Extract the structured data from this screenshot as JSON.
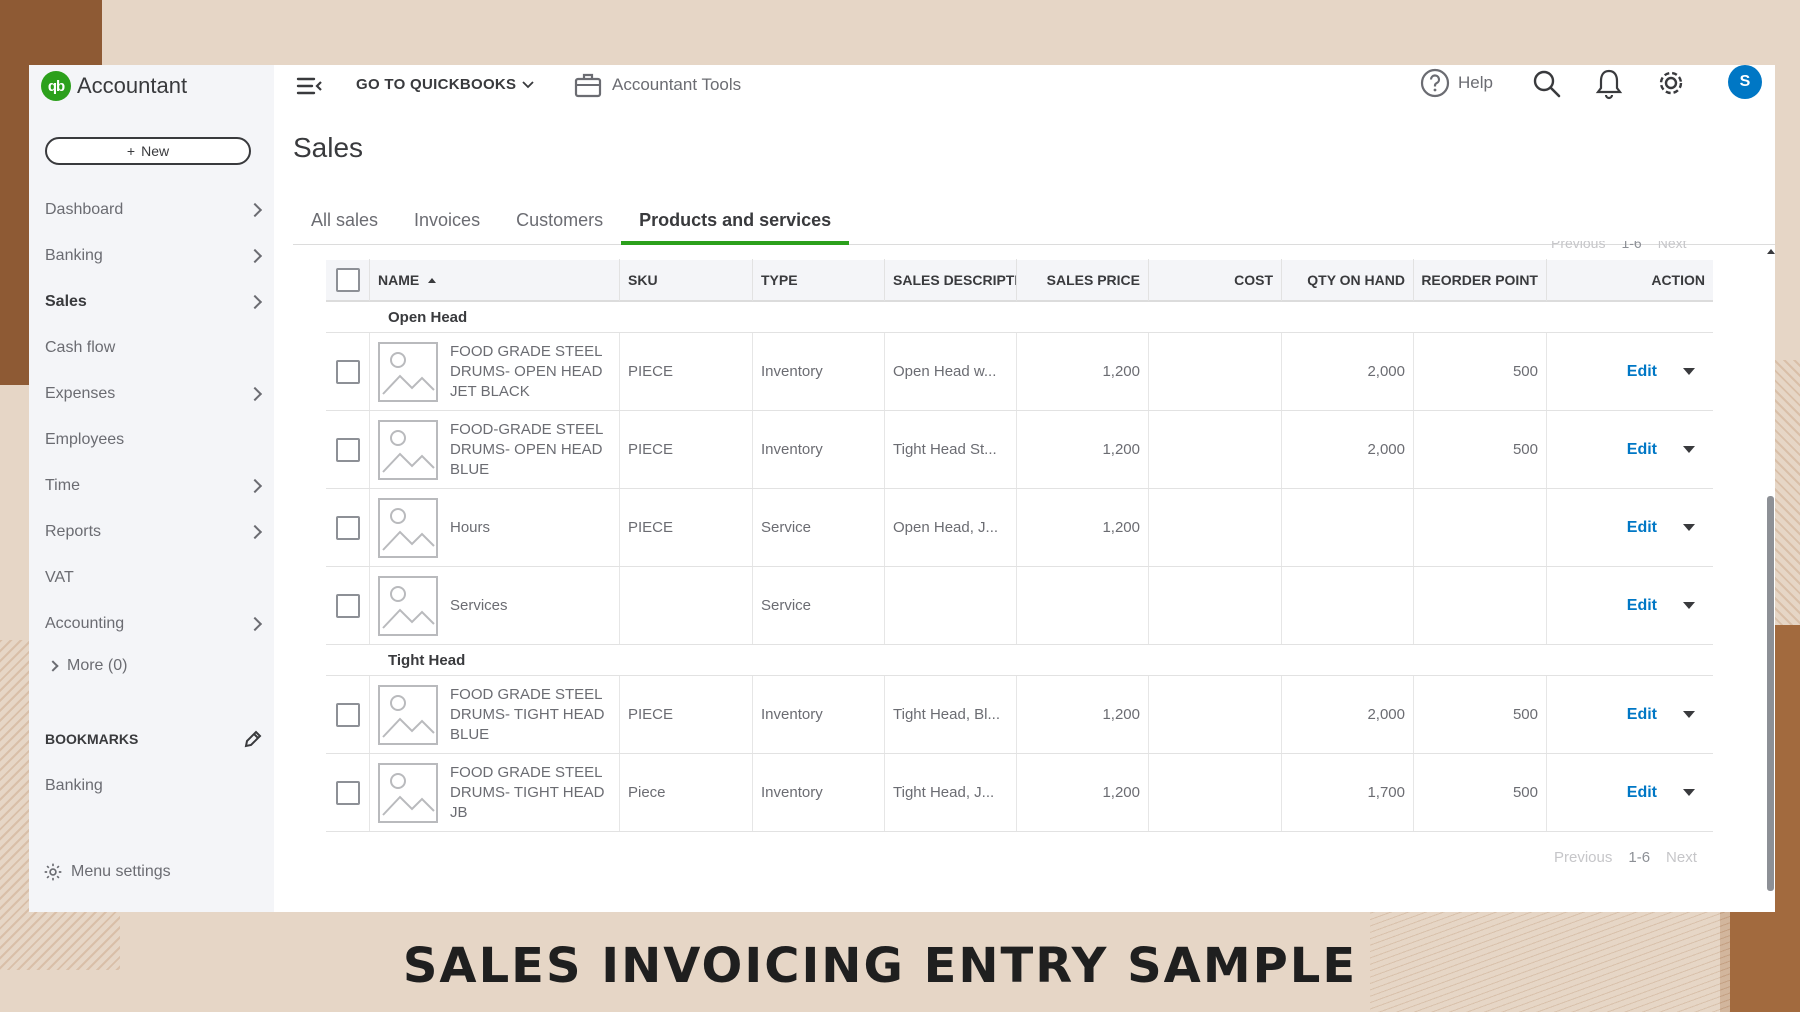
{
  "app": {
    "logo_mark": "qb",
    "logo_text": "Accountant",
    "new_label": "New",
    "sidebar": [
      {
        "label": "Dashboard",
        "chevron": true,
        "active": false
      },
      {
        "label": "Banking",
        "chevron": true,
        "active": false
      },
      {
        "label": "Sales",
        "chevron": true,
        "active": true
      },
      {
        "label": "Cash flow",
        "chevron": false,
        "active": false
      },
      {
        "label": "Expenses",
        "chevron": true,
        "active": false
      },
      {
        "label": "Employees",
        "chevron": false,
        "active": false
      },
      {
        "label": "Time",
        "chevron": true,
        "active": false
      },
      {
        "label": "Reports",
        "chevron": true,
        "active": false
      },
      {
        "label": "VAT",
        "chevron": false,
        "active": false
      },
      {
        "label": "Accounting",
        "chevron": true,
        "active": false
      }
    ],
    "more_label": "More (0)",
    "bookmarks_label": "BOOKMARKS",
    "bookmark_items": [
      "Banking"
    ],
    "menu_settings_label": "Menu settings"
  },
  "topbar": {
    "goto_label": "GO TO QUICKBOOKS",
    "accountant_tools_label": "Accountant Tools",
    "help_label": "Help",
    "avatar_initial": "S"
  },
  "page": {
    "title": "Sales",
    "tabs": [
      {
        "label": "All sales",
        "active": false
      },
      {
        "label": "Invoices",
        "active": false
      },
      {
        "label": "Customers",
        "active": false
      },
      {
        "label": "Products and services",
        "active": true
      }
    ],
    "pager": {
      "previous": "Previous",
      "range": "1-6",
      "next": "Next"
    }
  },
  "table": {
    "columns": {
      "name": "NAME",
      "sku": "SKU",
      "type": "TYPE",
      "desc": "SALES DESCRIPTIC",
      "price": "SALES PRICE",
      "cost": "COST",
      "qty": "QTY ON HAND",
      "reorder": "REORDER POINT",
      "action": "ACTION"
    },
    "groups": [
      {
        "name": "Open Head",
        "rows": [
          {
            "name": "FOOD GRADE STEEL DRUMS- OPEN HEAD JET BLACK",
            "sku": "PIECE",
            "type": "Inventory",
            "desc": "Open Head w...",
            "price": "1,200",
            "cost": "",
            "qty": "2,000",
            "reorder": "500"
          },
          {
            "name": "FOOD-GRADE STEEL DRUMS- OPEN HEAD BLUE",
            "sku": "PIECE",
            "type": "Inventory",
            "desc": "Tight Head St...",
            "price": "1,200",
            "cost": "",
            "qty": "2,000",
            "reorder": "500"
          },
          {
            "name": "Hours",
            "sku": "PIECE",
            "type": "Service",
            "desc": "Open Head, J...",
            "price": "1,200",
            "cost": "",
            "qty": "",
            "reorder": ""
          },
          {
            "name": "Services",
            "sku": "",
            "type": "Service",
            "desc": "",
            "price": "",
            "cost": "",
            "qty": "",
            "reorder": ""
          }
        ]
      },
      {
        "name": "Tight Head",
        "rows": [
          {
            "name": "FOOD GRADE STEEL DRUMS- TIGHT HEAD BLUE",
            "sku": "PIECE",
            "type": "Inventory",
            "desc": "Tight Head, Bl...",
            "price": "1,200",
            "cost": "",
            "qty": "2,000",
            "reorder": "500"
          },
          {
            "name": "FOOD GRADE STEEL DRUMS- TIGHT HEAD JB",
            "sku": "Piece",
            "type": "Inventory",
            "desc": "Tight Head, J...",
            "price": "1,200",
            "cost": "",
            "qty": "1,700",
            "reorder": "500"
          }
        ]
      }
    ],
    "edit_label": "Edit"
  },
  "caption": "SALES INVOICING ENTRY SAMPLE",
  "colors": {
    "brand_green": "#2ca01c",
    "link_blue": "#0077c5",
    "avatar_blue": "#0077c5"
  }
}
